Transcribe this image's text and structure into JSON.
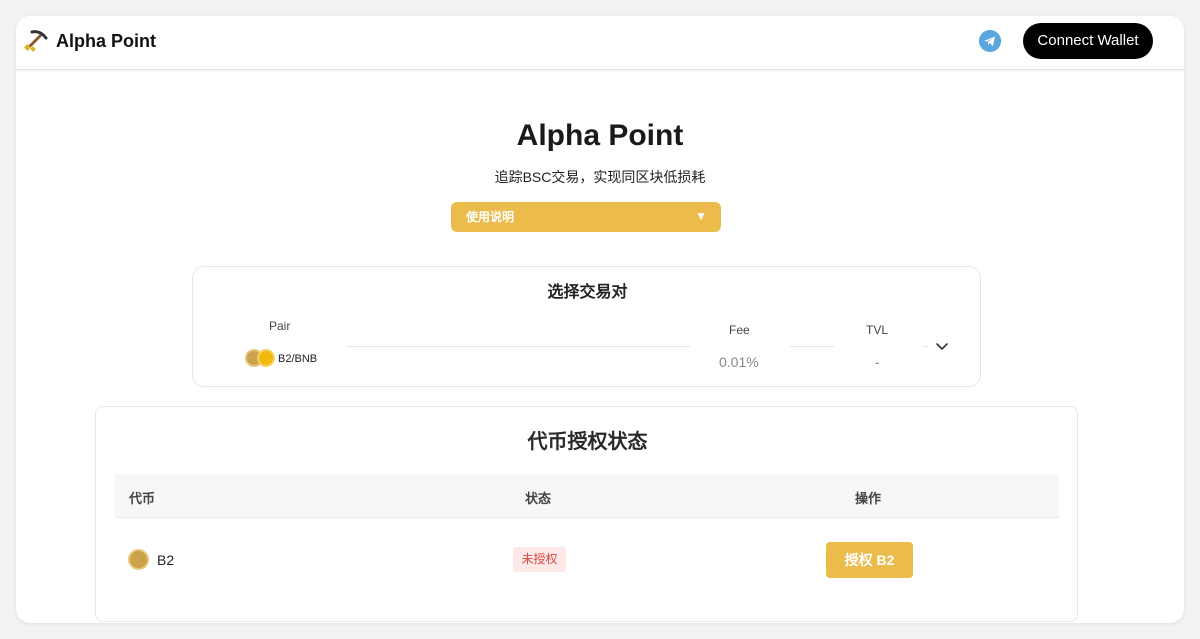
{
  "header": {
    "brand": "Alpha Point",
    "connect_label": "Connect Wallet",
    "logo_icon": "pickaxe-icon",
    "telegram_icon": "telegram-icon"
  },
  "hero": {
    "title": "Alpha Point",
    "subtitle": "追踪BSC交易，实现同区块低损耗",
    "guide_label": "使用说明",
    "guide_caret": "▼"
  },
  "pair_selector": {
    "title": "选择交易对",
    "col_pair": "Pair",
    "col_fee": "Fee",
    "col_tvl": "TVL",
    "selected_pair": "B2/BNB",
    "fee": "0.01%",
    "tvl": "-"
  },
  "auth": {
    "title": "代币授权状态",
    "headers": [
      "代币",
      "状态",
      "操作"
    ],
    "rows": [
      {
        "token": "B2",
        "status": "未授权",
        "action": "授权 B2"
      }
    ]
  },
  "colors": {
    "accent": "#ebbb4b",
    "unauthorized_bg": "#fde9e8",
    "unauthorized_text": "#d84b42",
    "telegram": "#5aa7e0"
  }
}
